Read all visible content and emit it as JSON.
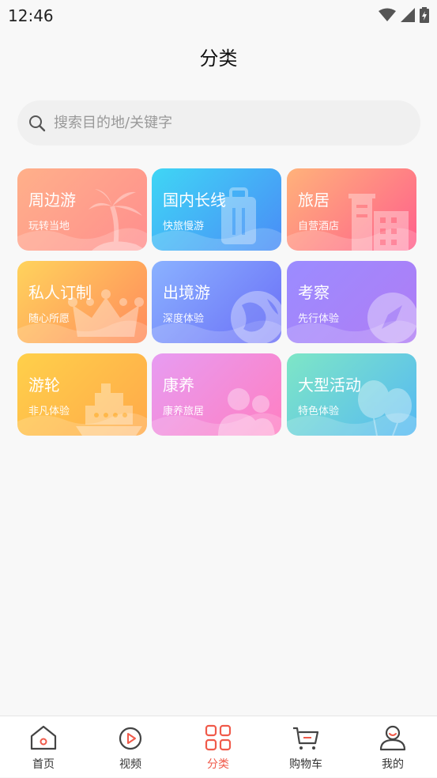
{
  "status": {
    "time": "12:46"
  },
  "header": {
    "title": "分类"
  },
  "search": {
    "placeholder": "搜索目的地/关键字"
  },
  "categories": [
    {
      "label": "周边游",
      "sub": "玩转当地",
      "icon": "palm-tree-icon",
      "gradient": [
        "#ffb08a",
        "#ff8e8e"
      ]
    },
    {
      "label": "国内长线",
      "sub": "快旅慢游",
      "icon": "luggage-icon",
      "gradient": [
        "#3fd6f5",
        "#4a8cf7"
      ]
    },
    {
      "label": "旅居",
      "sub": "自营酒店",
      "icon": "building-icon",
      "gradient": [
        "#ffb27a",
        "#ff5f8c"
      ]
    },
    {
      "label": "私人订制",
      "sub": "随心所愿",
      "icon": "crown-icon",
      "gradient": [
        "#ffd35c",
        "#ff8a5c"
      ]
    },
    {
      "label": "出境游",
      "sub": "深度体验",
      "icon": "globe-icon",
      "gradient": [
        "#8ab2ff",
        "#6b6ef7"
      ]
    },
    {
      "label": "考察",
      "sub": "先行体验",
      "icon": "compass-icon",
      "gradient": [
        "#9b8cff",
        "#b07cf5"
      ]
    },
    {
      "label": "游轮",
      "sub": "非凡体验",
      "icon": "ship-icon",
      "gradient": [
        "#ffd04a",
        "#ffa94a"
      ]
    },
    {
      "label": "康养",
      "sub": "康养旅居",
      "icon": "people-icon",
      "gradient": [
        "#e79cf2",
        "#ff7fc2"
      ]
    },
    {
      "label": "大型活动",
      "sub": "特色体验",
      "icon": "balloon-icon",
      "gradient": [
        "#7ee6c6",
        "#56b9f3"
      ]
    }
  ],
  "tabbar": {
    "items": [
      {
        "label": "首页",
        "icon": "home-icon",
        "active": false
      },
      {
        "label": "视频",
        "icon": "play-icon",
        "active": false
      },
      {
        "label": "分类",
        "icon": "grid-icon",
        "active": true
      },
      {
        "label": "购物车",
        "icon": "cart-icon",
        "active": false
      },
      {
        "label": "我的",
        "icon": "user-icon",
        "active": false
      }
    ]
  },
  "colors": {
    "accent": "#f05a4a",
    "background": "#f8f8f8"
  }
}
